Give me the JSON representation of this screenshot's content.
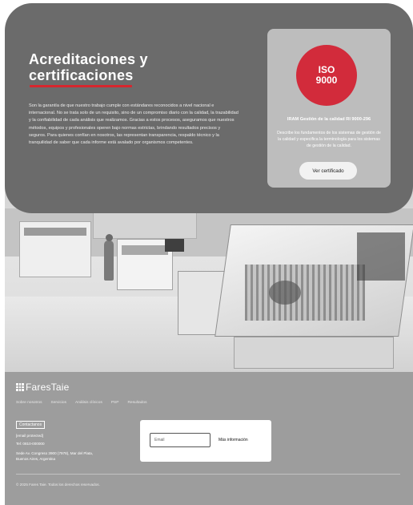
{
  "hero": {
    "title_line1": "Acreditaciones y",
    "title_line2": "certificaciones",
    "body": "Son la garantía de que nuestro trabajo cumple con estándares reconocidos a nivel nacional e internacional. No se trata solo de un requisito, sino de un compromiso diario con la calidad, la trazabilidad y la confiabilidad de cada análisis que realizamos. Gracias a estos procesos, aseguramos que nuestros métodos, equipos y profesionales operen bajo normas estrictas, brindando resultados precisos y seguros. Para quienes confían en nosotros, las representan transparencia, respaldo técnico y la tranquilidad de saber que cada informe está avalado por organismos competentes."
  },
  "certificate": {
    "badge_line1": "ISO",
    "badge_line2": "9000",
    "title": "IRAM Gestión de la calidad RI 9000-296",
    "description": "Describe los fundamentos de los sistemas de gestión de la calidad y especifica la terminología para los sistemas de gestión de la calidad.",
    "button_label": "Ver certificado",
    "badge_color": "#d22b3b"
  },
  "footer": {
    "brand": "FaresTaie",
    "nav": [
      "Sobre nosotros",
      "Servicios",
      "Análisis clínicos",
      "PSP",
      "Resultados"
    ],
    "contact_label": "Contactanos",
    "contact_lines": [
      "[email protected]",
      "Tel: 0810-000000",
      "Sede Av. Congreso 3900 (7978), Mar del Plata,",
      "Buenos Aires, Argentina"
    ],
    "newsletter": {
      "placeholder": "Email",
      "button_label": "Más información"
    },
    "copyright": "© 2025 Fares Taie. Todos los derechos reservados."
  },
  "colors": {
    "hero_bg": "#6b6b6b",
    "accent_red": "#d7262e",
    "footer_bg": "#9d9d9d"
  }
}
